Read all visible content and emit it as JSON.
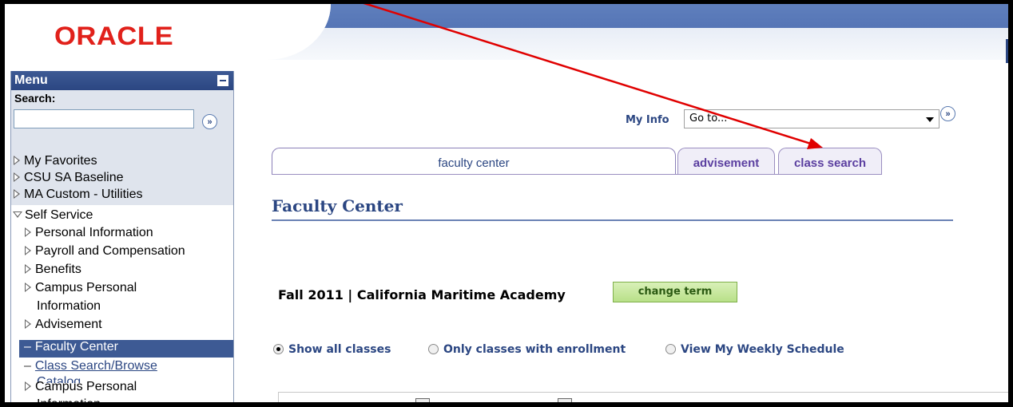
{
  "logo": {
    "text": "ORACLE"
  },
  "menu": {
    "title": "Menu",
    "search_label": "Search:",
    "search_value": "",
    "items": [
      {
        "label": "My Favorites",
        "state": "collapsed"
      },
      {
        "label": "CSU SA Baseline",
        "state": "collapsed"
      },
      {
        "label": "MA Custom - Utilities",
        "state": "collapsed"
      },
      {
        "label": "Self Service",
        "state": "expanded"
      },
      {
        "label": "Personal Information",
        "state": "collapsed"
      },
      {
        "label": "Payroll and Compensation",
        "state": "collapsed"
      },
      {
        "label": "Benefits",
        "state": "collapsed"
      },
      {
        "label": "Campus Personal",
        "label2": "Information",
        "state": "collapsed"
      },
      {
        "label": "Advisement",
        "state": "collapsed"
      },
      {
        "label": "Faculty Center",
        "state": "selected"
      },
      {
        "label": "Class Search/Browse",
        "label2": "Catalog",
        "state": "link"
      },
      {
        "label": "Campus Personal",
        "label2": "Information",
        "state": "collapsed"
      }
    ]
  },
  "myinfo": {
    "label": "My Info",
    "selected": "Go to..."
  },
  "tabs": [
    {
      "label": "faculty center",
      "active": true
    },
    {
      "label": "advisement",
      "active": false
    },
    {
      "label": "class search",
      "active": false
    }
  ],
  "page_title": "Faculty Center",
  "term": {
    "text": "Fall 2011 | California Maritime Academy",
    "button": "change term"
  },
  "view_options": [
    {
      "label": "Show all classes",
      "checked": true
    },
    {
      "label": "Only classes with enrollment",
      "checked": false
    },
    {
      "label": "View My Weekly Schedule",
      "checked": false
    }
  ],
  "colors": {
    "accent": "#2b4682",
    "oracle_red": "#e1211b",
    "annotation_arrow": "#e00000"
  }
}
